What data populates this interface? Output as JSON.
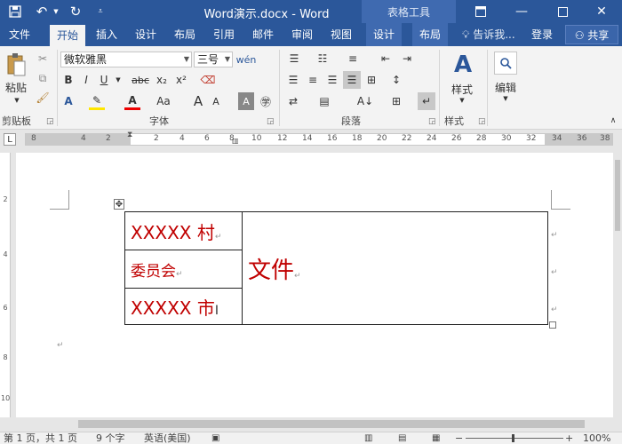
{
  "titlebar": {
    "title": "Word演示.docx - Word",
    "context_title": "表格工具",
    "quick_access": {
      "save_icon": "save-icon",
      "undo_icon": "undo-icon",
      "redo_icon": "redo-icon",
      "customize_icon": "chevron-down-icon"
    },
    "window_buttons": [
      "ribbon-display-icon",
      "minimize-icon",
      "maximize-icon",
      "close-icon"
    ]
  },
  "tabs": [
    {
      "label": "文件"
    },
    {
      "label": "开始",
      "active": true
    },
    {
      "label": "插入"
    },
    {
      "label": "设计"
    },
    {
      "label": "布局"
    },
    {
      "label": "引用"
    },
    {
      "label": "邮件"
    },
    {
      "label": "审阅"
    },
    {
      "label": "视图"
    },
    {
      "label": "设计"
    },
    {
      "label": "布局"
    }
  ],
  "tell_me": "告诉我...",
  "sign_in": "登录",
  "share": "共享",
  "ribbon": {
    "clipboard": {
      "label": "剪贴板",
      "paste": "粘贴"
    },
    "font": {
      "label": "字体",
      "font_name": "微软雅黑",
      "font_size": "三号",
      "bold": "B",
      "italic": "I",
      "underline": "U",
      "strike": "abc",
      "subscript": "x₂",
      "superscript": "x²",
      "aa": "Aa",
      "big_a": "A",
      "small_a": "A"
    },
    "paragraph": {
      "label": "段落"
    },
    "styles": {
      "label": "样式",
      "button": "样式"
    },
    "editing": {
      "button": "编辑"
    }
  },
  "ruler": {
    "ticks": [
      "8",
      "4",
      "2",
      "2",
      "4",
      "6",
      "8",
      "10",
      "12",
      "14",
      "16",
      "18",
      "20",
      "22",
      "24",
      "26",
      "28",
      "30",
      "32",
      "34",
      "36",
      "38"
    ]
  },
  "vruler_ticks": [
    "2",
    "4",
    "6",
    "8",
    "10"
  ],
  "document": {
    "cell_1": "XXXXX 村",
    "cell_2": "委员会",
    "cell_3": "XXXXX 市",
    "merged_cell": "文件",
    "paragraph_mark": "↵",
    "move_handle_icon": "move-handle-icon"
  },
  "status": {
    "page": "第 1 页，共 1 页",
    "words": "9 个字",
    "language": "英语(美国)",
    "zoom": "100%"
  },
  "colors": {
    "brand": "#2b579a",
    "doc_text": "#c00000"
  }
}
